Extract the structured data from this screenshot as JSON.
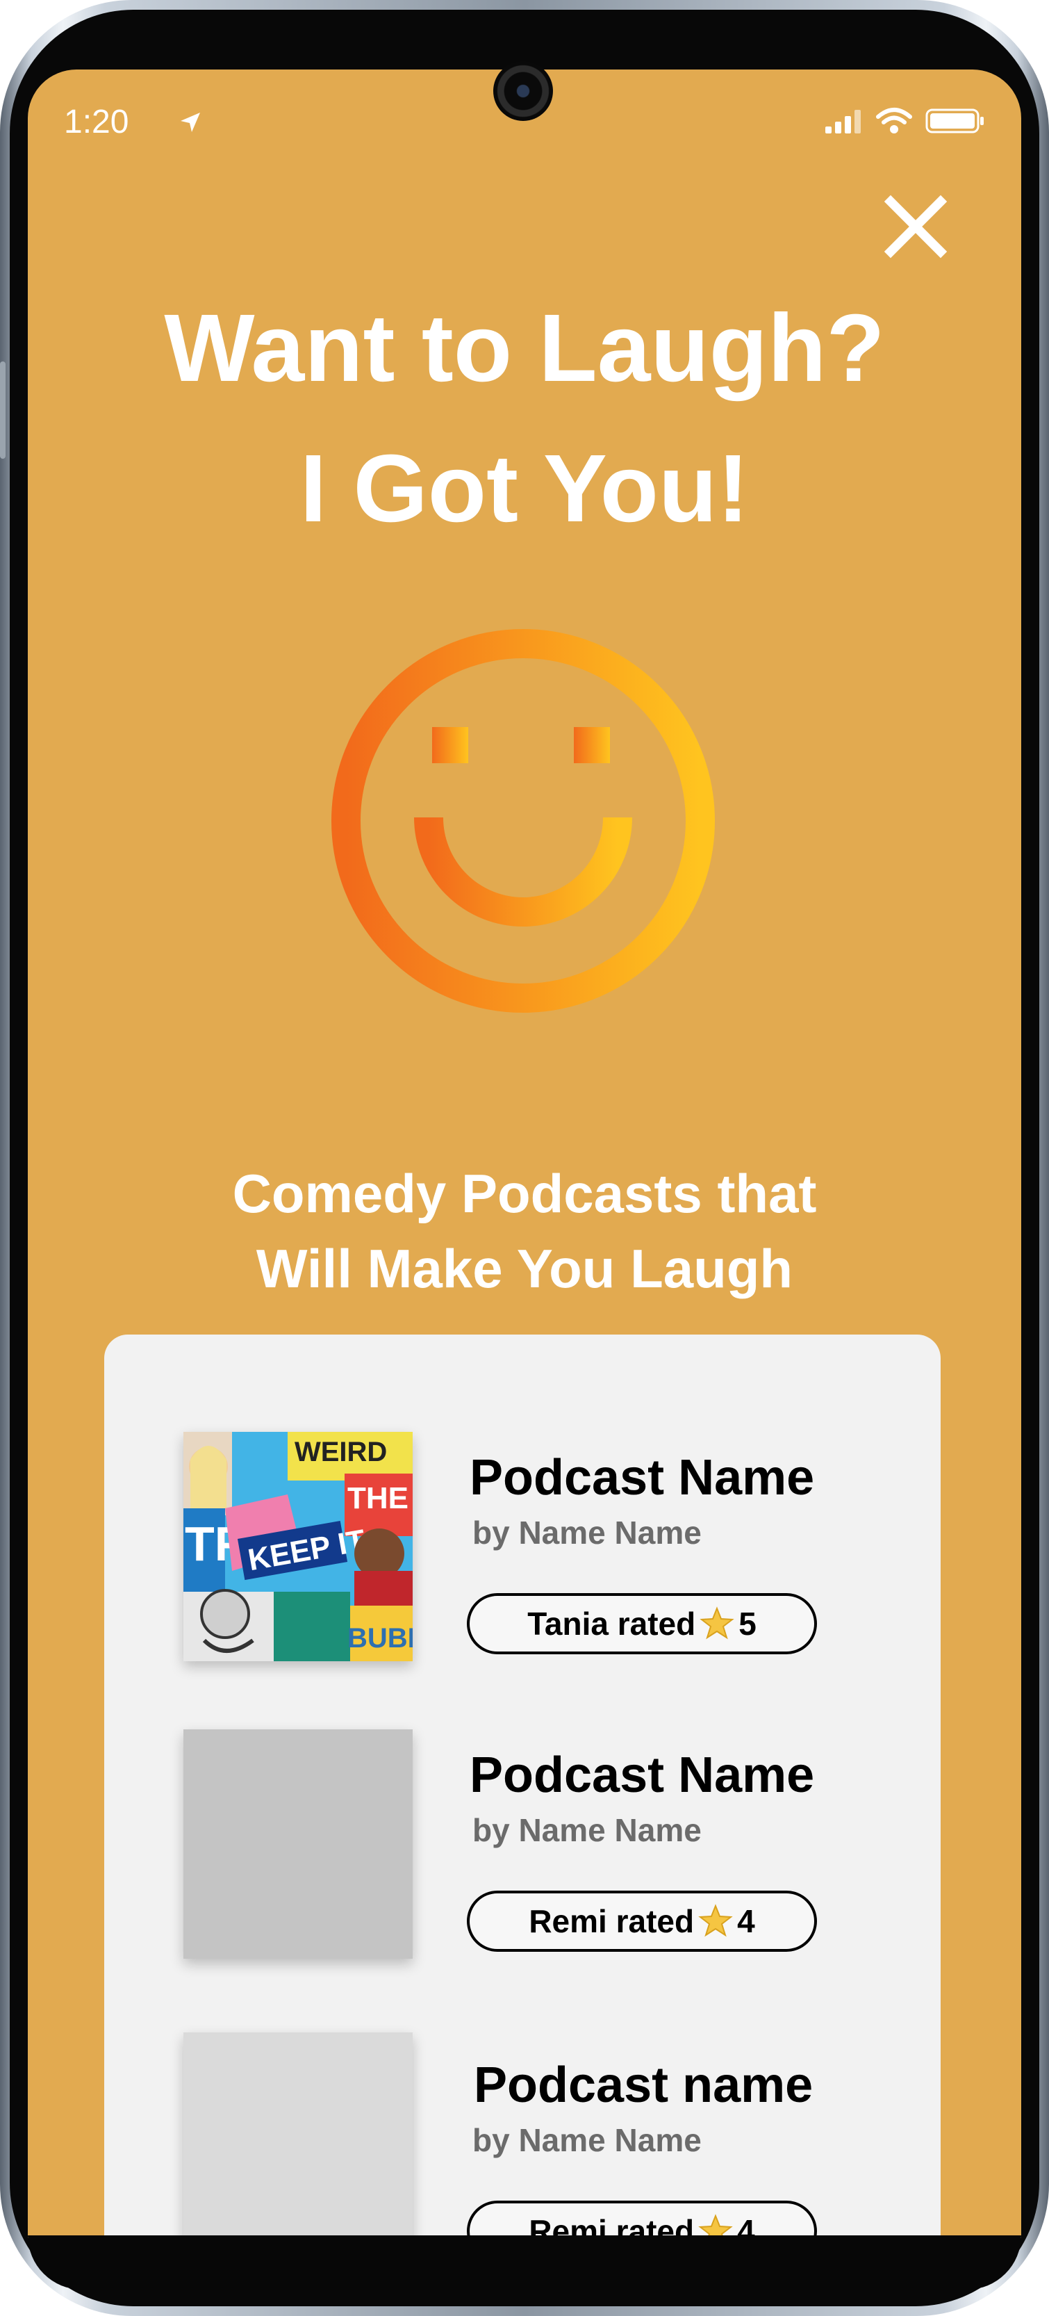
{
  "status_bar": {
    "time": "1:20",
    "icons": [
      "location-arrow-icon",
      "cellular-signal-icon",
      "wifi-icon",
      "battery-icon"
    ]
  },
  "close_icon": "close-icon",
  "headline": {
    "line1": "Want to Laugh?",
    "line2": "I Got You!"
  },
  "mood_icon": "smiley-face-icon",
  "section_title": {
    "line1": "Comedy Podcasts that",
    "line2": "Will Make You Laugh"
  },
  "podcasts": [
    {
      "name": "Podcast Name",
      "author": "by Name Name",
      "rating_prefix": "Tania rated",
      "rating": "5",
      "cover": "comedy-podcast-collage-image"
    },
    {
      "name": "Podcast Name",
      "author": "by Name Name",
      "rating_prefix": "Remi rated",
      "rating": "4",
      "cover": "placeholder-image"
    },
    {
      "name": "Podcast name",
      "author": "by Name Name",
      "rating_prefix": "Remi rated",
      "rating": "4",
      "cover": "placeholder-image"
    }
  ],
  "colors": {
    "background": "#e2aa50",
    "smiley_gradient_start": "#f26a1b",
    "smiley_gradient_end": "#ffc41f",
    "card": "#f2f2f2",
    "star": "#f5c542"
  }
}
